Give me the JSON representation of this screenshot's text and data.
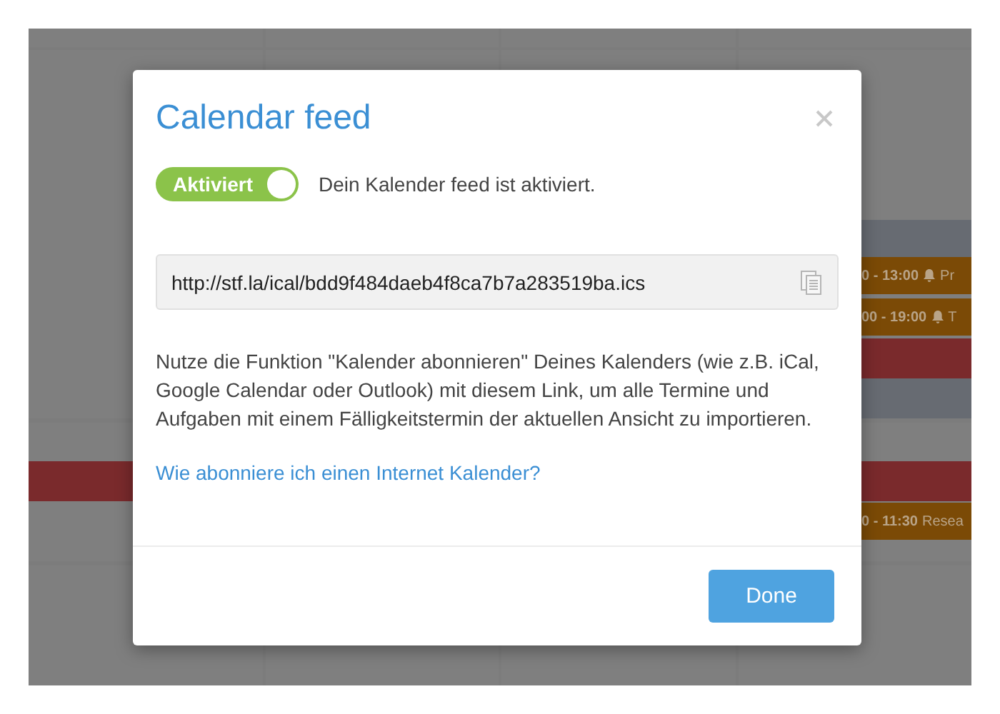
{
  "calendar": {
    "events": [
      {
        "time": "0 - 13:00",
        "bell": true,
        "title": "Pr",
        "color": "#7b4a06"
      },
      {
        "time": "00 - 19:00",
        "bell": true,
        "title": "T",
        "color": "#7b4a06"
      },
      {
        "time": "0 - 11:30",
        "bell": false,
        "title": "Resea",
        "color": "#7b4a06"
      }
    ]
  },
  "dialog": {
    "title": "Calendar feed",
    "toggle": {
      "label": "Aktiviert",
      "on": true
    },
    "status": "Dein Kalender feed ist aktiviert.",
    "feed_url": "http://stf.la/ical/bdd9f484daeb4f8ca7b7a283519ba.ics",
    "description": "Nutze die Funktion \"Kalender abonnieren\" Deines Kalenders (wie z.B. iCal, Google Calendar oder Outlook) mit diesem Link, um alle Termine und Aufgaben mit einem Fälligkeitstermin der aktuellen Ansicht zu importieren.",
    "help_link": "Wie abonniere ich einen Internet Kalender?",
    "buttons": [
      "Done"
    ]
  }
}
